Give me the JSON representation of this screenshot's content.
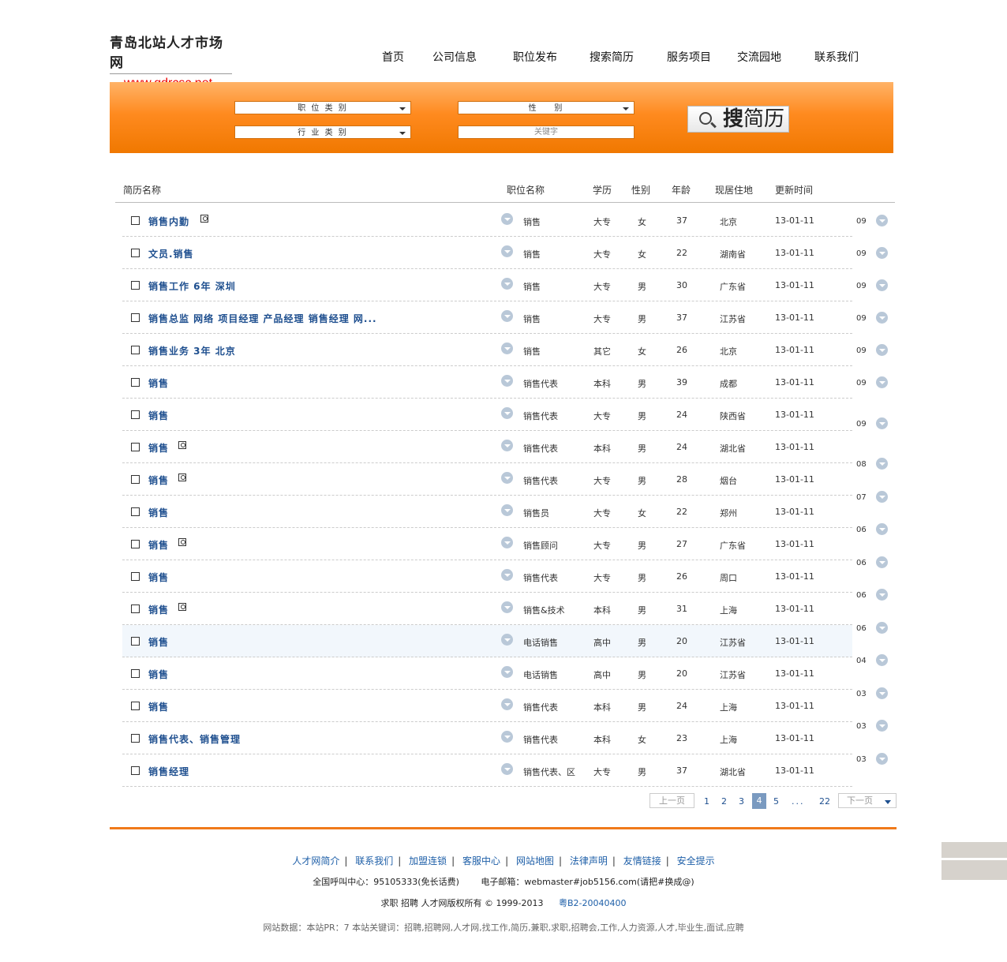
{
  "site": {
    "logo_cn": "青岛北站人才市场网",
    "logo_url": "www.qdrcsc.net"
  },
  "nav": [
    "首页",
    "公司信息",
    "职位发布",
    "搜索简历",
    "服务项目",
    "交流园地",
    "联系我们"
  ],
  "search": {
    "job_category": "职 位 类 别",
    "gender": "性    别",
    "industry": "行 业 类 别",
    "keyword_placeholder": "关键字",
    "button_icon_char": "搜",
    "button_label": "简历"
  },
  "table": {
    "headers": [
      "简历名称",
      "职位名称",
      "学历",
      "性别",
      "年龄",
      "现居住地",
      "更新时间"
    ],
    "rows": [
      {
        "name": "销售内勤",
        "photo": true,
        "job": "销售",
        "edu": "大专",
        "sex": "女",
        "age": "37",
        "loc": "北京",
        "date": "13-01-11"
      },
      {
        "name": "文员.销售",
        "photo": false,
        "job": "销售",
        "edu": "大专",
        "sex": "女",
        "age": "22",
        "loc": "湖南省",
        "date": "13-01-11"
      },
      {
        "name": "销售工作 6年 深圳",
        "photo": false,
        "job": "销售",
        "edu": "大专",
        "sex": "男",
        "age": "30",
        "loc": "广东省",
        "date": "13-01-11"
      },
      {
        "name": "销售总监 网络 项目经理 产品经理 销售经理 网...",
        "photo": false,
        "job": "销售",
        "edu": "大专",
        "sex": "男",
        "age": "37",
        "loc": "江苏省",
        "date": "13-01-11"
      },
      {
        "name": "销售业务 3年 北京",
        "photo": false,
        "job": "销售",
        "edu": "其它",
        "sex": "女",
        "age": "26",
        "loc": "北京",
        "date": "13-01-11"
      },
      {
        "name": "销售",
        "photo": false,
        "job": "销售代表",
        "edu": "本科",
        "sex": "男",
        "age": "39",
        "loc": "成都",
        "date": "13-01-11"
      },
      {
        "name": "销售",
        "photo": false,
        "job": "销售代表",
        "edu": "大专",
        "sex": "男",
        "age": "24",
        "loc": "陕西省",
        "date": "13-01-11"
      },
      {
        "name": "销售",
        "photo": true,
        "job": "销售代表",
        "edu": "本科",
        "sex": "男",
        "age": "24",
        "loc": "湖北省",
        "date": "13-01-11"
      },
      {
        "name": "销售",
        "photo": true,
        "job": "销售代表",
        "edu": "大专",
        "sex": "男",
        "age": "28",
        "loc": "烟台",
        "date": "13-01-11"
      },
      {
        "name": "销售",
        "photo": false,
        "job": "销售员",
        "edu": "大专",
        "sex": "女",
        "age": "22",
        "loc": "郑州",
        "date": "13-01-11"
      },
      {
        "name": "销售",
        "photo": true,
        "job": "销售顾问",
        "edu": "大专",
        "sex": "男",
        "age": "27",
        "loc": "广东省",
        "date": "13-01-11"
      },
      {
        "name": "销售",
        "photo": false,
        "job": "销售代表",
        "edu": "大专",
        "sex": "男",
        "age": "26",
        "loc": "周口",
        "date": "13-01-11"
      },
      {
        "name": "销售",
        "photo": true,
        "job": "销售&技术",
        "edu": "本科",
        "sex": "男",
        "age": "31",
        "loc": "上海",
        "date": "13-01-11"
      },
      {
        "name": "销售",
        "photo": false,
        "job": "电话销售",
        "edu": "高中",
        "sex": "男",
        "age": "20",
        "loc": "江苏省",
        "date": "13-01-11",
        "highlight": true
      },
      {
        "name": "销售",
        "photo": false,
        "job": "电话销售",
        "edu": "高中",
        "sex": "男",
        "age": "20",
        "loc": "江苏省",
        "date": "13-01-11"
      },
      {
        "name": "销售",
        "photo": false,
        "job": "销售代表",
        "edu": "本科",
        "sex": "男",
        "age": "24",
        "loc": "上海",
        "date": "13-01-11"
      },
      {
        "name": "销售代表、销售管理",
        "photo": false,
        "job": "销售代表",
        "edu": "本科",
        "sex": "女",
        "age": "23",
        "loc": "上海",
        "date": "13-01-11"
      },
      {
        "name": "销售经理",
        "photo": false,
        "job": "销售代表、区",
        "edu": "大专",
        "sex": "男",
        "age": "37",
        "loc": "湖北省",
        "date": "13-01-11"
      }
    ],
    "right_col": [
      "09",
      "09",
      "09",
      "09",
      "09",
      "09",
      "09",
      "08",
      "07",
      "06",
      "06",
      "06",
      "06",
      "04",
      "03",
      "03",
      "03"
    ]
  },
  "pager": {
    "prev": "上一页",
    "pages": [
      "1",
      "2",
      "3",
      "4",
      "5"
    ],
    "current": "4",
    "ellipsis": "...",
    "last": "22",
    "next": "下一页"
  },
  "footer": {
    "links": [
      "人才网简介",
      "联系我们",
      "加盟连锁",
      "客服中心",
      "网站地图",
      "法律声明",
      "友情链接",
      "安全提示"
    ],
    "hotline": "全国呼叫中心：95105333(免长话费)",
    "email": "电子邮箱：webmaster#job5156.com(请把#换成@)",
    "copyright": "求职 招聘  人才网版权所有 © 1999-2013",
    "icp": "粤B2-20040400",
    "seo": "网站数据：本站PR：7  本站关键词：招聘,招聘网,人才网,找工作,简历,兼职,求职,招聘会,工作,人力资源,人才,毕业生,面试,应聘"
  }
}
